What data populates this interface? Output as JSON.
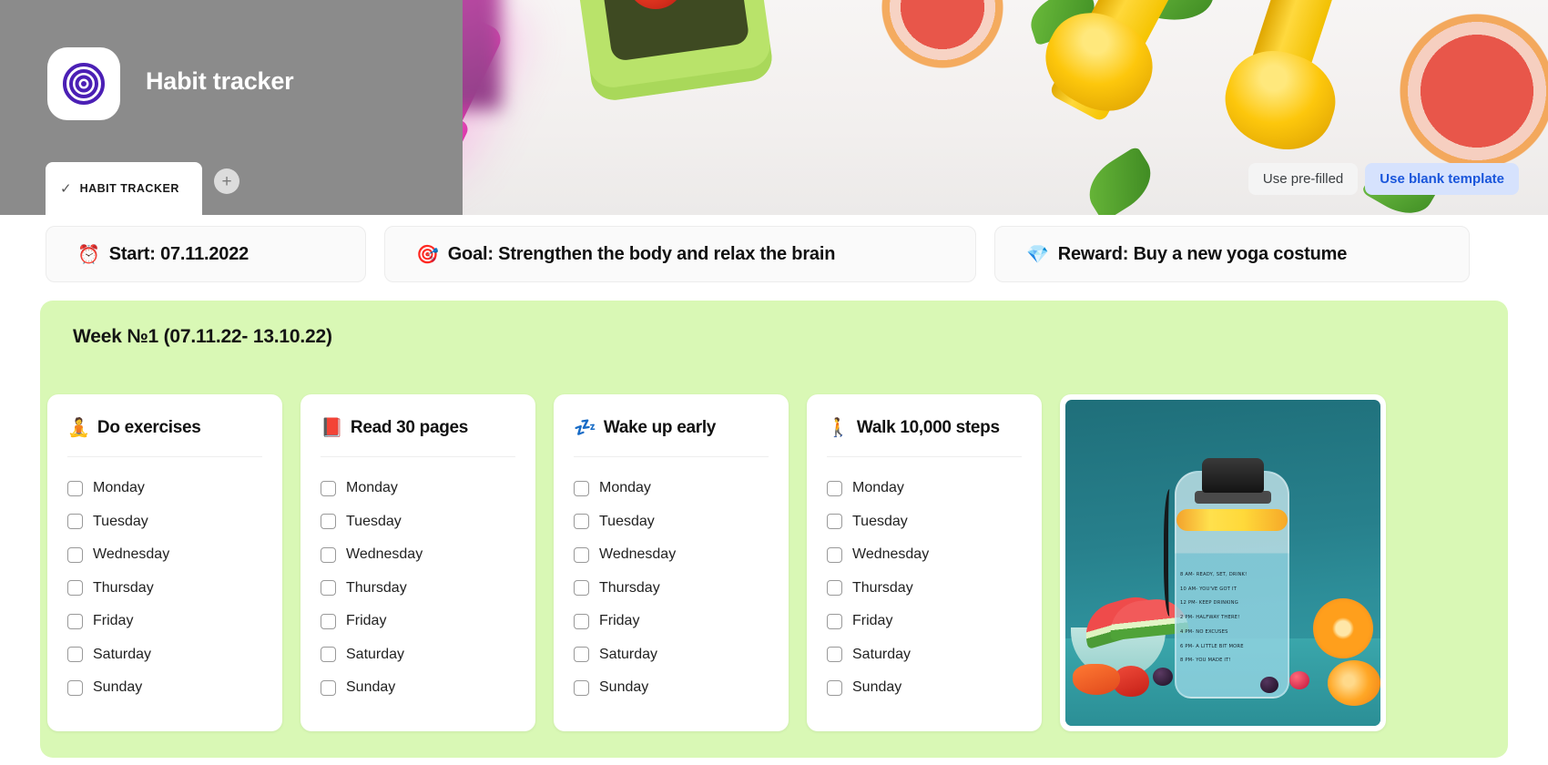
{
  "app": {
    "title": "Habit tracker",
    "icon": "target-icon"
  },
  "tab": {
    "label": "HABIT TRACKER",
    "check": "✓",
    "add_label": "+"
  },
  "hero_actions": {
    "prefilled_label": "Use pre-filled",
    "blank_label": "Use blank template",
    "blank_color": "#1a56db",
    "blank_bg": "#d6e2fd"
  },
  "info": [
    {
      "emoji": "⏰",
      "text": "Start: 07.11.2022",
      "name": "start"
    },
    {
      "emoji": "🎯",
      "text": "Goal: Strengthen the body and relax the brain",
      "name": "goal"
    },
    {
      "emoji": "💎",
      "text": "Reward: Buy a new yoga costume",
      "name": "reward"
    }
  ],
  "week": {
    "title": "Week №1 (07.11.22- 13.10.22)",
    "panel_color": "#d9f8b5"
  },
  "habits": [
    {
      "emoji": "🧘",
      "name": "Do exercises",
      "days": [
        "Monday",
        "Tuesday",
        "Wednesday",
        "Thursday",
        "Friday",
        "Saturday",
        "Sunday"
      ]
    },
    {
      "emoji": "📕",
      "name": "Read 30 pages",
      "days": [
        "Monday",
        "Tuesday",
        "Wednesday",
        "Thursday",
        "Friday",
        "Saturday",
        "Sunday"
      ]
    },
    {
      "emoji": "💤",
      "name": "Wake up early",
      "days": [
        "Monday",
        "Tuesday",
        "Wednesday",
        "Thursday",
        "Friday",
        "Saturday",
        "Sunday"
      ]
    },
    {
      "emoji": "🚶",
      "name": "Walk 10,000 steps",
      "days": [
        "Monday",
        "Tuesday",
        "Wednesday",
        "Thursday",
        "Friday",
        "Saturday",
        "Sunday"
      ]
    }
  ],
  "photo_card": {
    "caption_lines": [
      "8 AM- READY, SET, DRINK!",
      "10 AM- YOU'VE GOT IT",
      "12 PM- KEEP DRINKING",
      "2 PM- HALFWAY THERE!",
      "4 PM- NO EXCUSES",
      "6 PM- A LITTLE BIT MORE",
      "8 PM- YOU MADE IT!"
    ]
  }
}
